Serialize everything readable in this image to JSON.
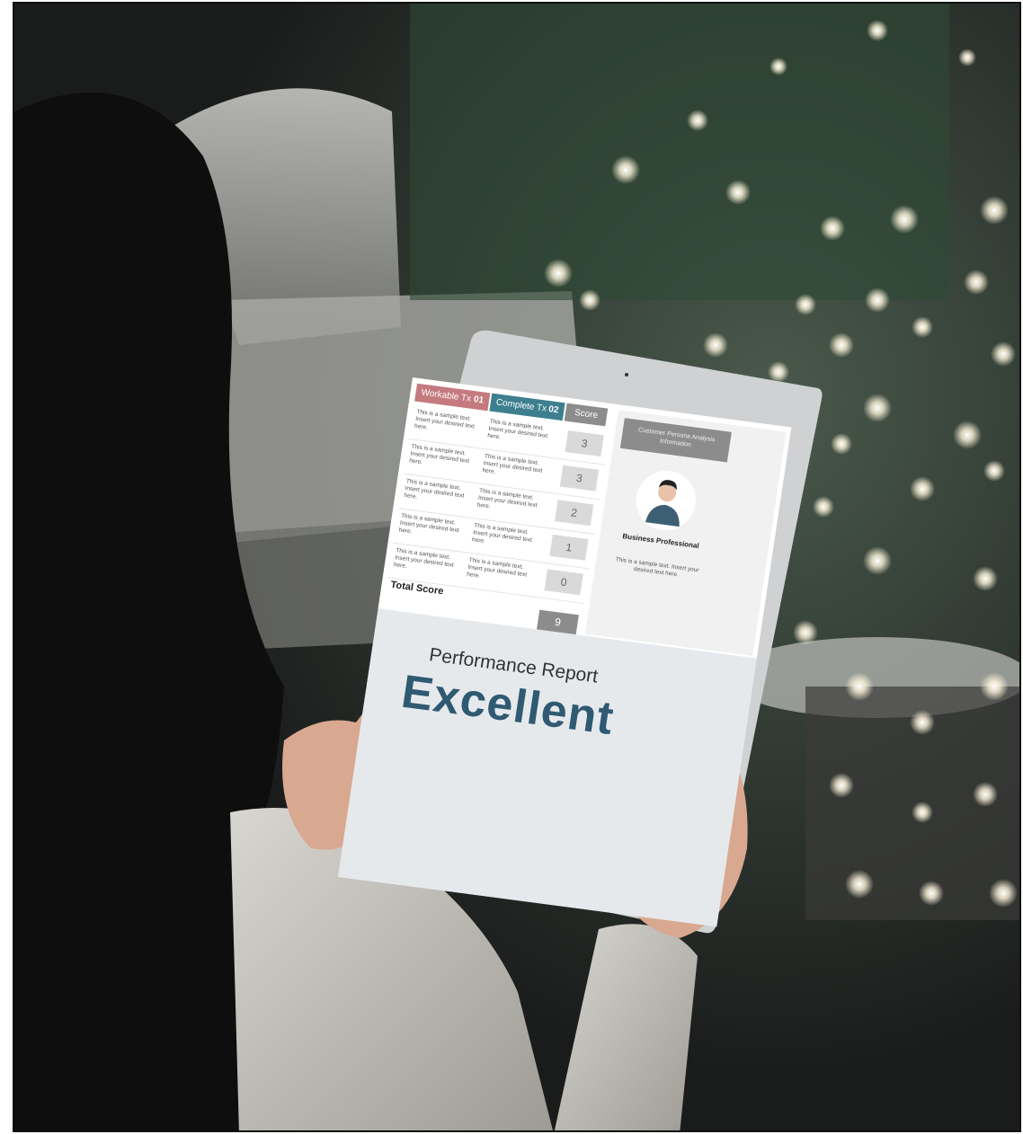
{
  "screen": {
    "tabs": {
      "workable_label": "Workable Tx",
      "workable_num": "01",
      "complete_label": "Complete Tx",
      "complete_num": "02",
      "score_label": "Score"
    },
    "rows": [
      {
        "col_a": "This is a sample text. Insert your desired text here.",
        "col_b": "This is a sample text. Insert your desired text here.",
        "score": "3"
      },
      {
        "col_a": "This is a sample text. Insert your desired text here.",
        "col_b": "This is a sample text. Insert your desired text here.",
        "score": "3"
      },
      {
        "col_a": "This is a sample text. Insert your desired text here.",
        "col_b": "This is a sample text. Insert your desired text here.",
        "score": "2"
      },
      {
        "col_a": "This is a sample text. Insert your desired text here.",
        "col_b": "This is a sample text. Insert your desired text here.",
        "score": "1"
      },
      {
        "col_a": "This is a sample text. Insert your desired text here.",
        "col_b": "This is a sample text. Insert your desired text here.",
        "score": "0"
      }
    ],
    "total_label": "Total Score",
    "total_value": "9",
    "side": {
      "header": "Customer Persona Analysis Information",
      "name": "Business Professional",
      "desc": "This is a sample text. Insert your desired text here."
    },
    "report_subtitle": "Performance Report",
    "report_title": "Excellent"
  },
  "colors": {
    "workable_tab": "#c47a7e",
    "complete_tab": "#3d7f8f",
    "score_gray": "#8c8c8c",
    "title_blue": "#2f5a72"
  }
}
